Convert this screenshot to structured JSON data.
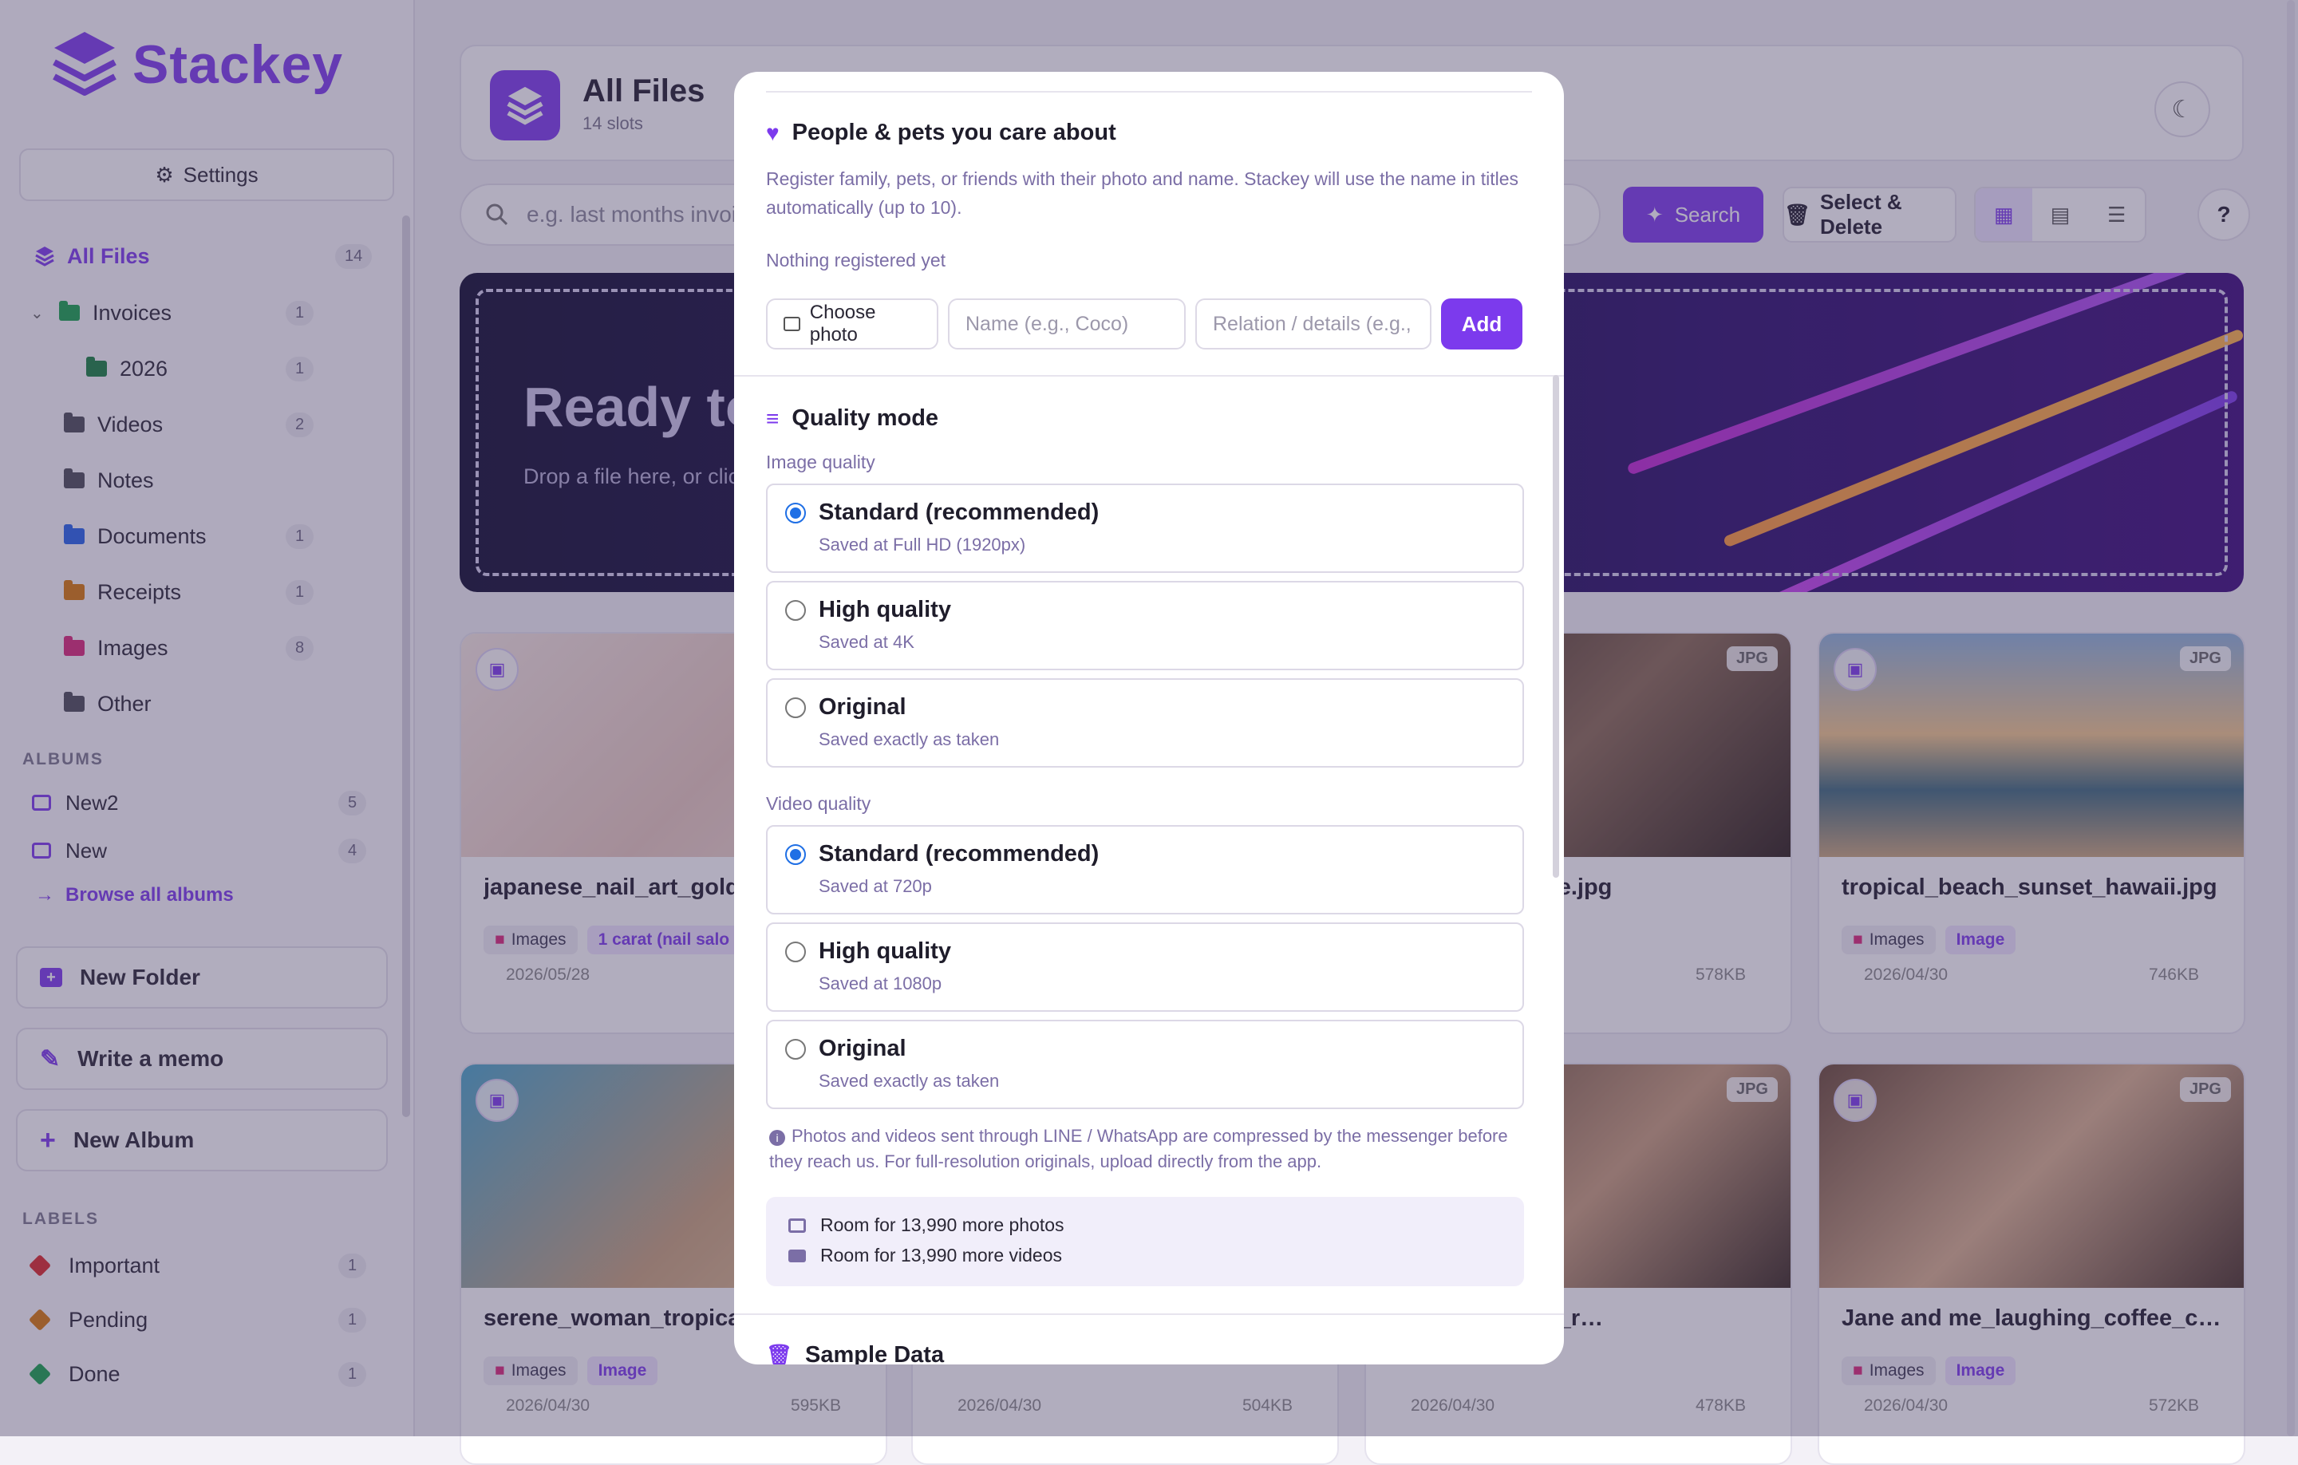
{
  "app": {
    "name": "Stackey"
  },
  "sidebar": {
    "settings_label": "Settings",
    "all_files": {
      "label": "All Files",
      "count": "14"
    },
    "folders": [
      {
        "label": "Invoices",
        "count": "1",
        "color": "#16a34a"
      },
      {
        "label": "2026",
        "count": "1",
        "color": "#15803d"
      },
      {
        "label": "Videos",
        "count": "2",
        "color": "#4b4b55"
      },
      {
        "label": "Notes",
        "count": "",
        "color": "#4b4b55"
      },
      {
        "label": "Documents",
        "count": "1",
        "color": "#2563eb"
      },
      {
        "label": "Receipts",
        "count": "1",
        "color": "#d97706"
      },
      {
        "label": "Images",
        "count": "8",
        "color": "#db2777"
      },
      {
        "label": "Other",
        "count": "",
        "color": "#4b4b55"
      }
    ],
    "albums_heading": "ALBUMS",
    "albums": [
      {
        "label": "New2",
        "count": "5"
      },
      {
        "label": "New",
        "count": "4"
      }
    ],
    "browse_albums": "Browse all albums",
    "new_folder": "New Folder",
    "write_memo": "Write a memo",
    "new_album": "New Album",
    "labels_heading": "LABELS",
    "labels": [
      {
        "label": "Important",
        "count": "1",
        "color": "#dc2626"
      },
      {
        "label": "Pending",
        "count": "1",
        "color": "#d97706"
      },
      {
        "label": "Done",
        "count": "1",
        "color": "#16a34a"
      }
    ]
  },
  "header": {
    "title": "All Files",
    "subtitle": "14 slots"
  },
  "toolbar": {
    "search_placeholder": "e.g. last months invoi",
    "search_label": "Search",
    "select_delete_label": "Select & Delete",
    "help_label": "?"
  },
  "banner": {
    "title": "Ready to",
    "subtitle": "Drop a file here, or clic"
  },
  "cards": [
    {
      "name": "japanese_nail_art_gold_",
      "chips": [
        "Images",
        "1 carat (nail salo"
      ],
      "badge": "",
      "date": "2026/05/28",
      "size": ""
    },
    {
      "name": "aughing_at_cafe.jpg",
      "chips": [],
      "badge": "JPG",
      "date": "",
      "size": "578KB"
    },
    {
      "name": "tropical_beach_sunset_hawaii.jpg",
      "chips": [
        "Images",
        "Image"
      ],
      "badge": "JPG",
      "date": "2026/04/30",
      "size": "746KB"
    },
    {
      "name": "serene_woman_tropical_",
      "chips": [
        "Images",
        "Image"
      ],
      "badge": "",
      "date": "2026/04/30",
      "size": "595KB"
    },
    {
      "name": "",
      "chips": [],
      "badge": "",
      "date": "2026/04/30",
      "size": "504KB"
    },
    {
      "name": "breakfast_plate_r…",
      "chips": [],
      "badge": "JPG",
      "date": "2026/04/30",
      "size": "478KB"
    },
    {
      "name": "Jane and me_laughing_coffee_caf…",
      "chips": [
        "Images",
        "Image"
      ],
      "badge": "JPG",
      "date": "2026/04/30",
      "size": "572KB"
    }
  ],
  "modal": {
    "people": {
      "title": "People & pets you care about",
      "description": "Register family, pets, or friends with their photo and name. Stackey will use the name in titles automatically (up to 10).",
      "empty": "Nothing registered yet",
      "choose_photo": "Choose photo",
      "name_placeholder": "Name (e.g., Coco)",
      "relation_placeholder": "Relation / details (e.g.,",
      "add_label": "Add"
    },
    "quality": {
      "title": "Quality mode",
      "image_heading": "Image quality",
      "image_options": [
        {
          "title": "Standard (recommended)",
          "sub": "Saved at Full HD (1920px)",
          "selected": true
        },
        {
          "title": "High quality",
          "sub": "Saved at 4K",
          "selected": false
        },
        {
          "title": "Original",
          "sub": "Saved exactly as taken",
          "selected": false
        }
      ],
      "video_heading": "Video quality",
      "video_options": [
        {
          "title": "Standard (recommended)",
          "sub": "Saved at 720p",
          "selected": true
        },
        {
          "title": "High quality",
          "sub": "Saved at 1080p",
          "selected": false
        },
        {
          "title": "Original",
          "sub": "Saved exactly as taken",
          "selected": false
        }
      ],
      "note": "Photos and videos sent through LINE / WhatsApp are compressed by the messenger before they reach us. For full-resolution originals, upload directly from the app.",
      "photos_room": "Room for 13,990 more photos",
      "videos_room": "Room for 13,990 more videos"
    },
    "sample_title": "Sample Data"
  },
  "colors": {
    "accent": "#7c3aed",
    "radio": "#1f6fe5"
  }
}
